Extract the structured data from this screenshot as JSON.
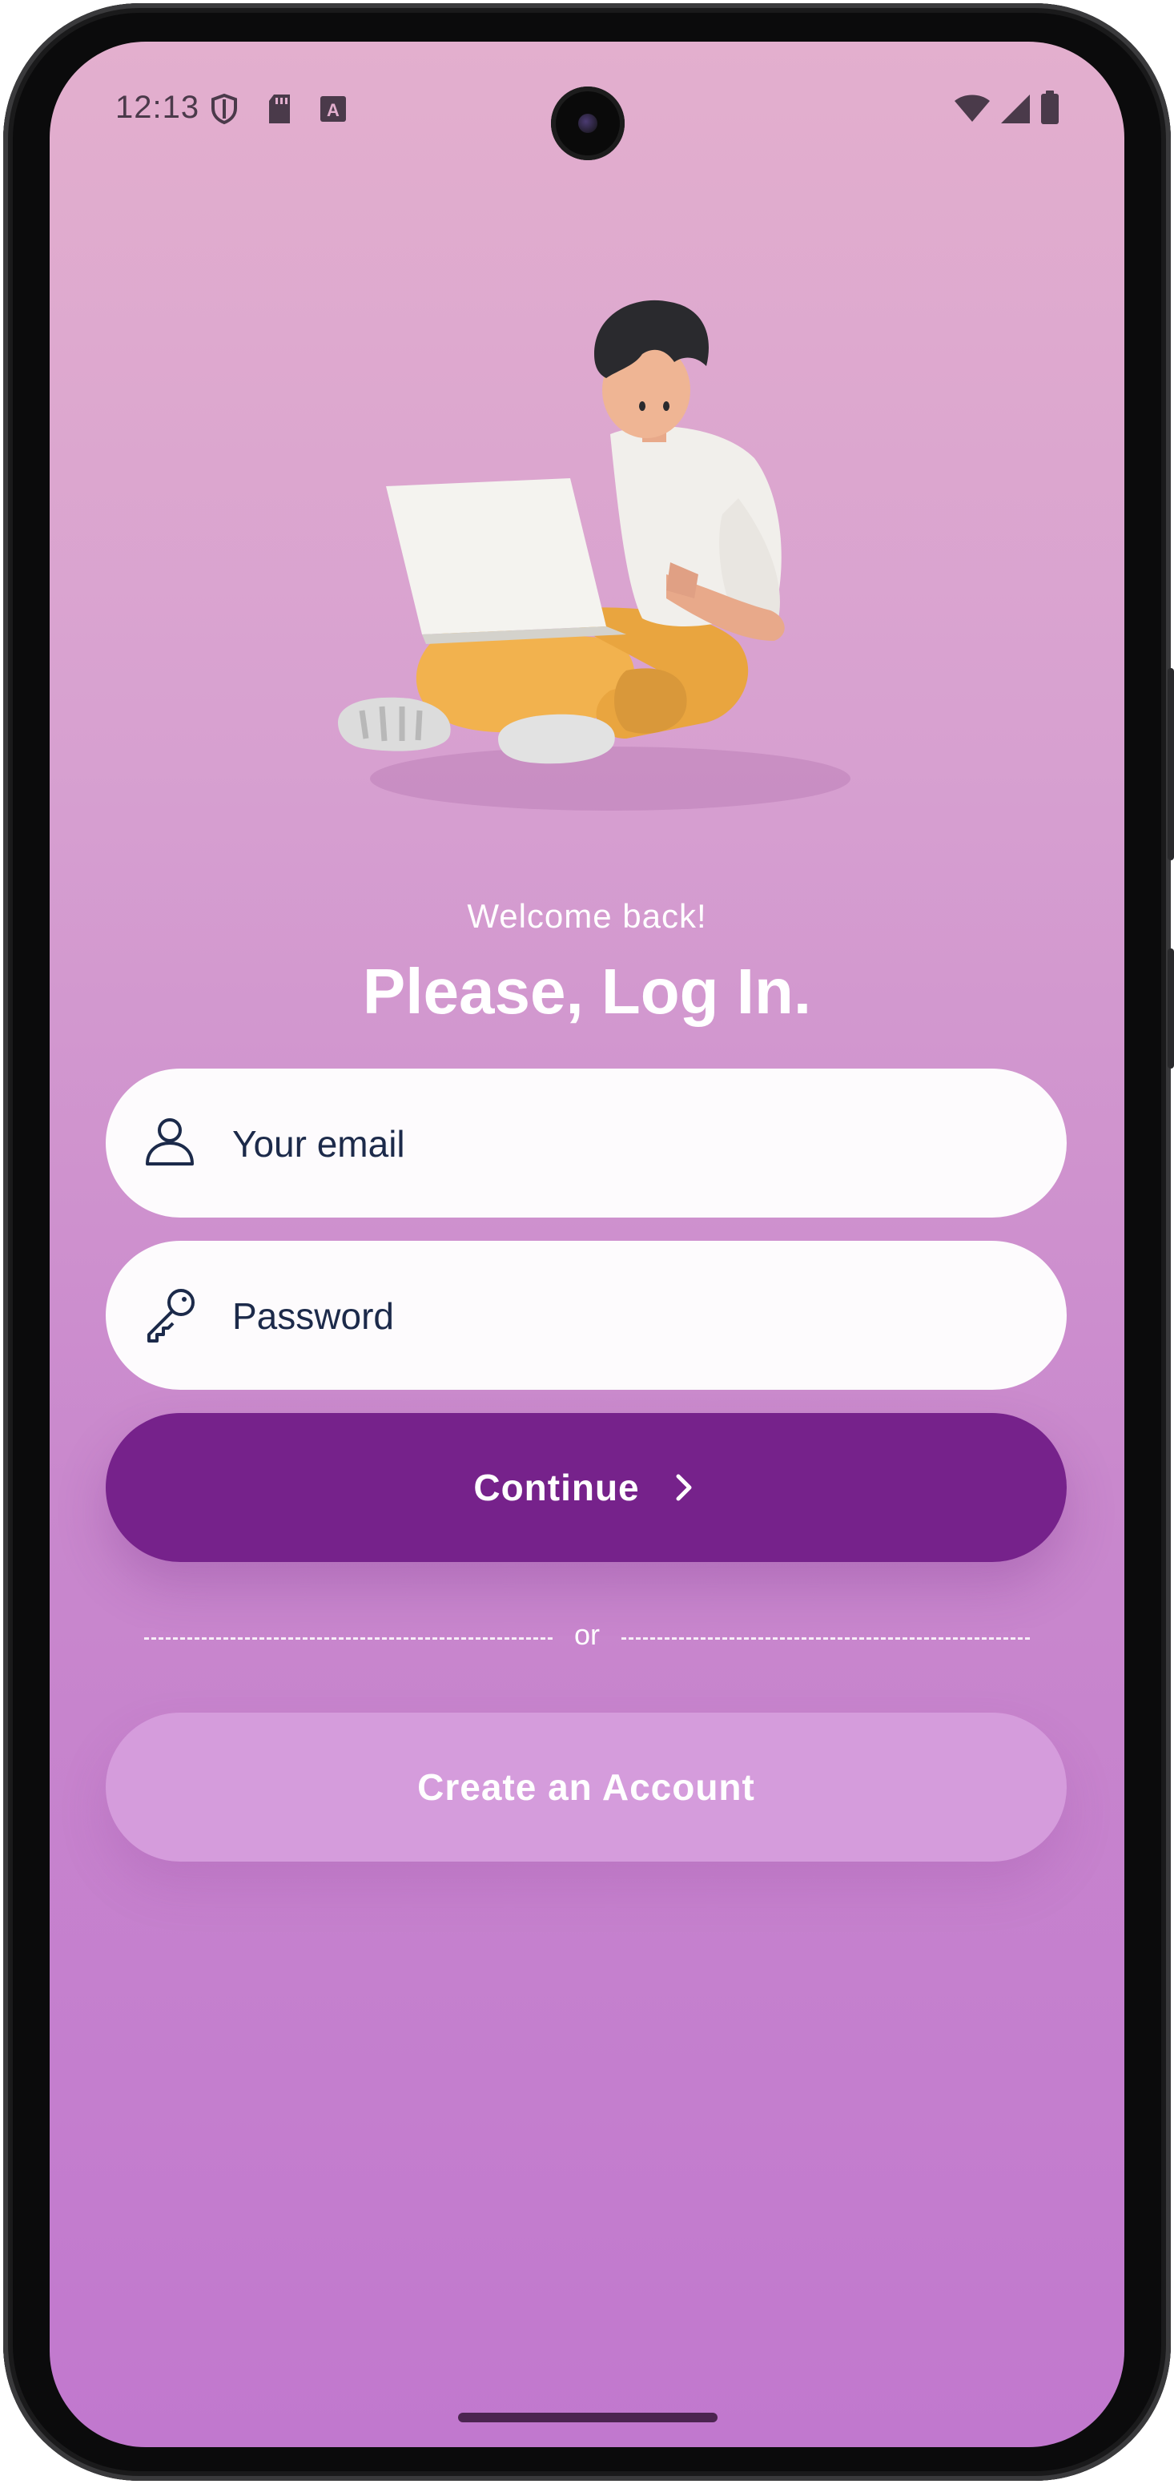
{
  "status_bar": {
    "time": "12:13",
    "left_icons": [
      "shield-icon",
      "sd-card-icon",
      "keyboard-a-icon"
    ],
    "right_icons": [
      "wifi-icon",
      "cellular-signal-icon",
      "battery-icon"
    ]
  },
  "illustration": {
    "icon": "person-with-laptop-illustration"
  },
  "login": {
    "greeting": "Welcome back!",
    "title": "Please, Log In.",
    "email_placeholder": "Your email",
    "email_value": "",
    "password_placeholder": "Password",
    "password_value": "",
    "continue_label": "Continue",
    "divider_text": "or",
    "create_account_label": "Create an Account"
  },
  "colors": {
    "background_top": "#e3afce",
    "background_bottom": "#c178ce",
    "primary_button": "#76228b",
    "secondary_button": "#d59cdc",
    "field_background": "#fdfbfd",
    "field_text": "#1c2a4a"
  }
}
